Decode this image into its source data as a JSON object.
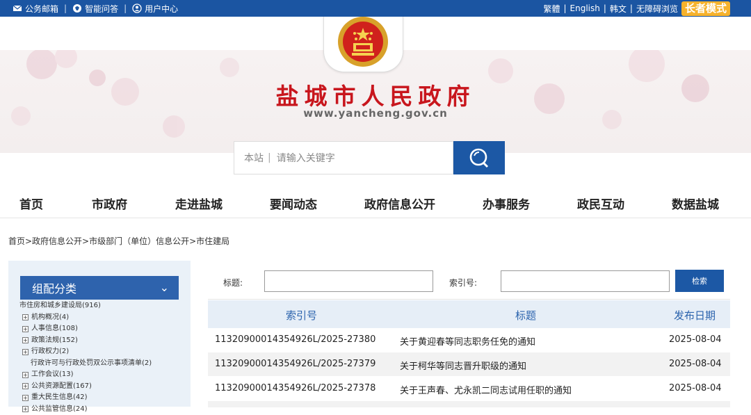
{
  "topbar": {
    "links": [
      {
        "icon": "mail-icon",
        "label": "公务邮箱"
      },
      {
        "icon": "chat-icon",
        "label": "智能问答"
      },
      {
        "icon": "user-icon",
        "label": "用户中心"
      }
    ],
    "right": {
      "traditional": "繁體",
      "english": "English",
      "korean": "韩文",
      "accessible": "无障碍浏览",
      "elder_mode": "长者模式"
    }
  },
  "header": {
    "site_name": "盐城市人民政府",
    "site_url": "www.yancheng.gov.cn",
    "emblem": "national-emblem-icon"
  },
  "search": {
    "scope": "本站",
    "placeholder": "请输入关键字",
    "icon": "search-icon"
  },
  "nav": [
    "首页",
    "市政府",
    "走进盐城",
    "要闻动态",
    "政府信息公开",
    "办事服务",
    "政民互动",
    "数据盐城"
  ],
  "breadcrumb": "首页>政府信息公开>市级部门（单位）信息公开>市住建局",
  "sidebar": {
    "title": "组配分类",
    "root": "市住房和城乡建设局(916)",
    "items": [
      {
        "label": "机构概况(4)",
        "expandable": true
      },
      {
        "label": "人事信息(108)",
        "expandable": true
      },
      {
        "label": "政策法规(152)",
        "expandable": true
      },
      {
        "label": "行政权力(2)",
        "expandable": true
      },
      {
        "label": "行政许可与行政处罚双公示事项清单(2)",
        "expandable": false,
        "child": true
      },
      {
        "label": "工作会议(13)",
        "expandable": true
      },
      {
        "label": "公共资源配置(167)",
        "expandable": true
      },
      {
        "label": "重大民生信息(42)",
        "expandable": true
      },
      {
        "label": "公共监管信息(24)",
        "expandable": true
      }
    ]
  },
  "filter": {
    "title_label": "标题:",
    "index_label": "索引号:",
    "title_value": "",
    "index_value": "",
    "search_button": "检索"
  },
  "table": {
    "headers": [
      "索引号",
      "标题",
      "发布日期"
    ],
    "rows": [
      {
        "index": "11320900014354926L/2025-27380",
        "title": "关于黄迎春等同志职务任免的通知",
        "date": "2025-08-04"
      },
      {
        "index": "11320900014354926L/2025-27379",
        "title": "关于柯华等同志晋升职级的通知",
        "date": "2025-08-04"
      },
      {
        "index": "11320900014354926L/2025-27378",
        "title": "关于王声春、尤永凯二同志试用任职的通知",
        "date": "2025-08-04"
      }
    ]
  },
  "colors": {
    "topbar": "#1b55a2",
    "title_red": "#c8161d",
    "accent_blue": "#1c58a5",
    "elder_orange": "#f6b22c"
  }
}
